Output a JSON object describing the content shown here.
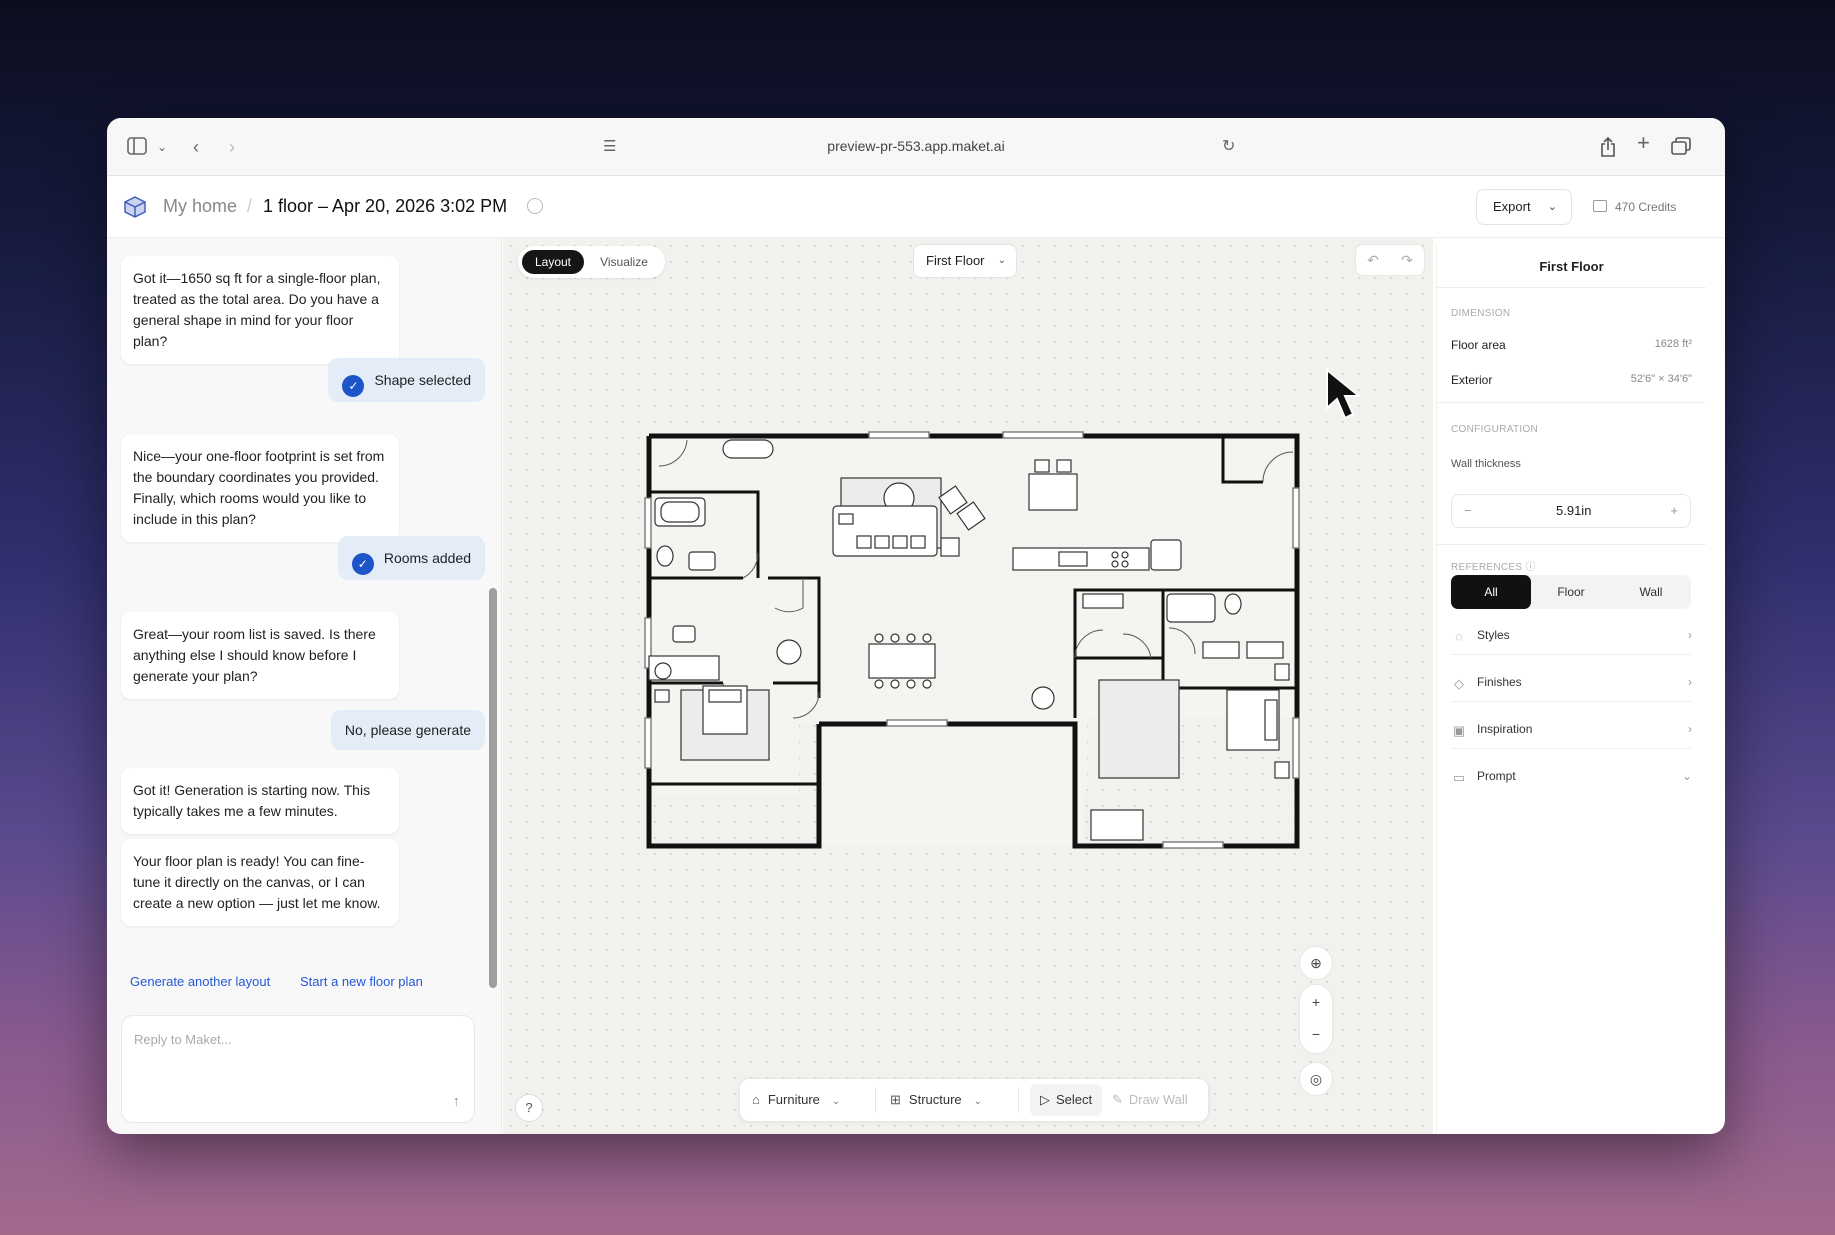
{
  "browser": {
    "url": "preview-pr-553.app.maket.ai"
  },
  "header": {
    "breadcrumb_home": "My home",
    "breadcrumb_sep": "/",
    "title": "1 floor – Apr 20, 2026 3:02 PM",
    "export_label": "Export",
    "credits": "470 Credits"
  },
  "chat": {
    "messages": [
      {
        "role": "assistant",
        "text": "Got it—1650 sq ft for a single-floor plan, treated as the total area. Do you have a general shape in mind for your floor plan?"
      },
      {
        "role": "user",
        "text": "Shape selected"
      },
      {
        "role": "assistant",
        "text": "Nice—your one-floor footprint is set from the boundary coordinates you provided. Finally, which rooms would you like to include in this plan?"
      },
      {
        "role": "user",
        "text": "Rooms added"
      },
      {
        "role": "assistant",
        "text": "Great—your room list is saved. Is there anything else I should know before I generate your plan?"
      },
      {
        "role": "user",
        "text": "No, please generate"
      },
      {
        "role": "assistant",
        "text": "Got it! Generation is starting now. This typically takes me a few minutes."
      },
      {
        "role": "assistant",
        "text": "Your floor plan is ready! You can fine-tune it directly on the canvas, or I can create a new option — just let me know."
      }
    ],
    "suggestion_1": "Generate another layout",
    "suggestion_2": "Start a new floor plan",
    "reply_placeholder": "Reply to Maket..."
  },
  "canvas": {
    "view_tabs": [
      "Layout",
      "Visualize"
    ],
    "active_view": "Layout",
    "floor_select": "First Floor",
    "help": "?",
    "zoom_in": "+",
    "zoom_out": "−",
    "toolbar": {
      "furniture": "Furniture",
      "structure": "Structure",
      "select": "Select",
      "draw_wall": "Draw Wall"
    }
  },
  "panel": {
    "title": "First Floor",
    "dimension_label": "DIMENSION",
    "floor_area_label": "Floor area",
    "floor_area_value": "1628 ft²",
    "exterior_label": "Exterior",
    "exterior_value": "52'6\" × 34'6\"",
    "configuration_label": "CONFIGURATION",
    "wall_thickness_label": "Wall thickness",
    "wall_thickness_value": "5.91in",
    "references_label": "REFERENCES",
    "ref_tabs": [
      "All",
      "Floor",
      "Wall"
    ],
    "active_ref_tab": "All",
    "links": [
      "Styles",
      "Finishes",
      "Inspiration",
      "Prompt"
    ]
  },
  "colors": {
    "accent": "#1d55c9",
    "dark": "#151515",
    "canvas_bg": "#f2f1ee"
  }
}
